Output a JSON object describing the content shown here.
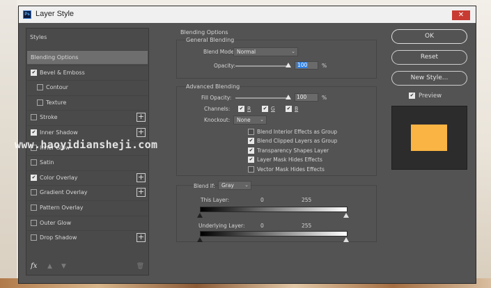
{
  "window": {
    "title": "Layer Style",
    "close_glyph": "✕",
    "app_icon_text": "Ps"
  },
  "styles_panel": {
    "header": "Styles",
    "items": [
      {
        "label": "Blending Options",
        "has_checkbox": false,
        "checked": false,
        "selected": true,
        "indent": false,
        "has_plus": false
      },
      {
        "label": "Bevel & Emboss",
        "has_checkbox": true,
        "checked": true,
        "selected": false,
        "indent": false,
        "has_plus": false
      },
      {
        "label": "Contour",
        "has_checkbox": true,
        "checked": false,
        "selected": false,
        "indent": true,
        "has_plus": false
      },
      {
        "label": "Texture",
        "has_checkbox": true,
        "checked": false,
        "selected": false,
        "indent": true,
        "has_plus": false
      },
      {
        "label": "Stroke",
        "has_checkbox": true,
        "checked": false,
        "selected": false,
        "indent": false,
        "has_plus": true
      },
      {
        "label": "Inner Shadow",
        "has_checkbox": true,
        "checked": true,
        "selected": false,
        "indent": false,
        "has_plus": true
      },
      {
        "label": "Inner Glow",
        "has_checkbox": true,
        "checked": false,
        "selected": false,
        "indent": false,
        "has_plus": false
      },
      {
        "label": "Satin",
        "has_checkbox": true,
        "checked": false,
        "selected": false,
        "indent": false,
        "has_plus": false
      },
      {
        "label": "Color Overlay",
        "has_checkbox": true,
        "checked": true,
        "selected": false,
        "indent": false,
        "has_plus": true
      },
      {
        "label": "Gradient Overlay",
        "has_checkbox": true,
        "checked": false,
        "selected": false,
        "indent": false,
        "has_plus": true
      },
      {
        "label": "Pattern Overlay",
        "has_checkbox": true,
        "checked": false,
        "selected": false,
        "indent": false,
        "has_plus": false
      },
      {
        "label": "Outer Glow",
        "has_checkbox": true,
        "checked": false,
        "selected": false,
        "indent": false,
        "has_plus": false
      },
      {
        "label": "Drop Shadow",
        "has_checkbox": true,
        "checked": false,
        "selected": false,
        "indent": false,
        "has_plus": true
      }
    ],
    "footer": {
      "fx": "fx",
      "up": "▲",
      "down": "▼",
      "trash": "🗑"
    }
  },
  "blending": {
    "section_title": "Blending Options",
    "general_title": "General Blending",
    "blend_mode_label": "Blend Mode:",
    "blend_mode_value": "Normal",
    "opacity_label": "Opacity:",
    "opacity_value": "100",
    "percent": "%",
    "advanced_title": "Advanced Blending",
    "fill_opacity_label": "Fill Opacity:",
    "fill_opacity_value": "100",
    "channels_label": "Channels:",
    "channels": [
      {
        "label": "R",
        "checked": true
      },
      {
        "label": "G",
        "checked": true
      },
      {
        "label": "B",
        "checked": true
      }
    ],
    "knockout_label": "Knockout:",
    "knockout_value": "None",
    "options": [
      {
        "label": "Blend Interior Effects as Group",
        "checked": false
      },
      {
        "label": "Blend Clipped Layers as Group",
        "checked": true
      },
      {
        "label": "Transparency Shapes Layer",
        "checked": true
      },
      {
        "label": "Layer Mask Hides Effects",
        "checked": true
      },
      {
        "label": "Vector Mask Hides Effects",
        "checked": false
      }
    ],
    "blend_if_label": "Blend If:",
    "blend_if_value": "Gray",
    "this_layer_label": "This Layer:",
    "this_layer_min": "0",
    "this_layer_max": "255",
    "underlying_label": "Underlying Layer:",
    "underlying_min": "0",
    "underlying_max": "255"
  },
  "buttons": {
    "ok": "OK",
    "reset": "Reset",
    "new_style": "New Style..."
  },
  "preview": {
    "label": "Preview",
    "checked": true,
    "swatch_color": "#f9b443"
  },
  "watermark": "www.haoyidiansheji.com",
  "check_glyph": "✔",
  "chevron_glyph": "⌄"
}
